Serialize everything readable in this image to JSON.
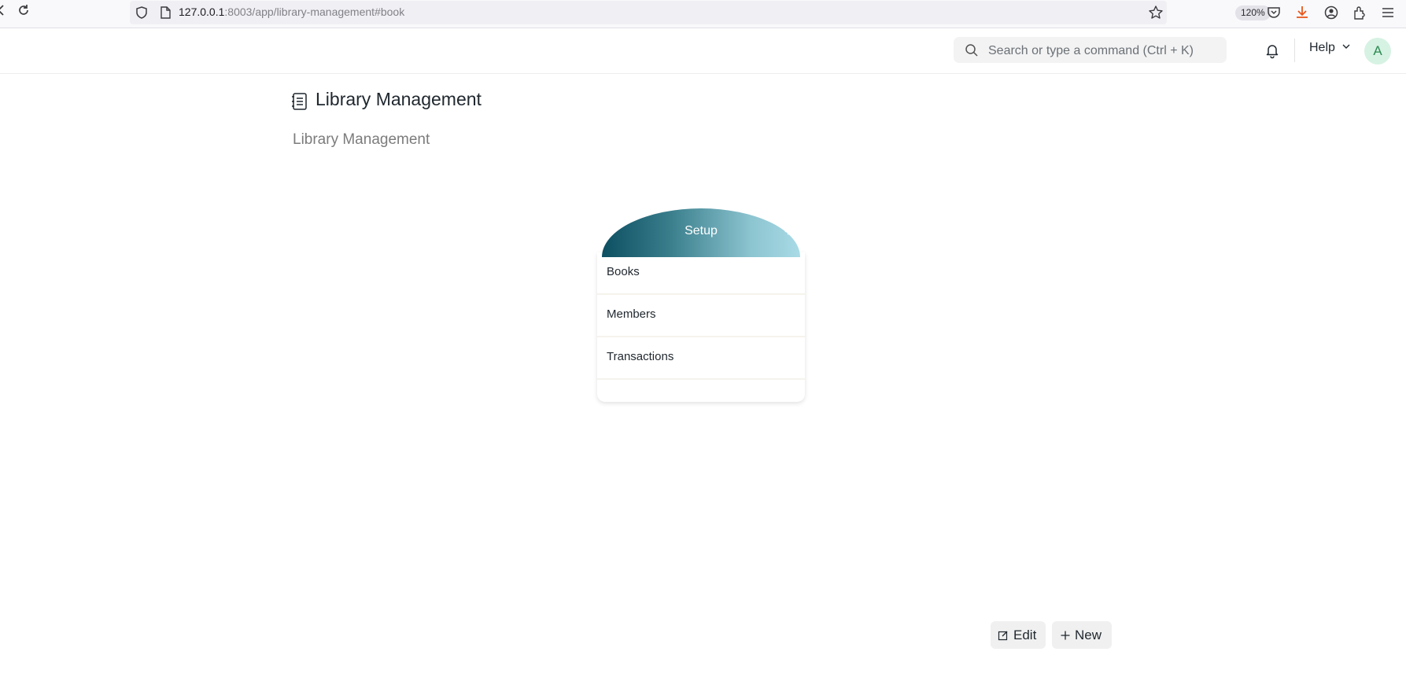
{
  "browser": {
    "url_host": "127.0.0.1",
    "url_path": ":8003/app/library-management#book",
    "zoom": "120%"
  },
  "navbar": {
    "search_placeholder": "Search or type a command (Ctrl + K)",
    "help_label": "Help",
    "avatar_initial": "A"
  },
  "page": {
    "title": "Library Management",
    "subtitle": "Library Management"
  },
  "card": {
    "title": "Setup",
    "items": [
      {
        "label": "Books"
      },
      {
        "label": "Members"
      },
      {
        "label": "Transactions"
      }
    ]
  },
  "actions": {
    "edit_label": "Edit",
    "new_label": "New"
  },
  "colors": {
    "card_gradient_start": "#0c4f62",
    "card_gradient_end": "#a8dbe6",
    "avatar_bg": "#d6f2e3",
    "download_icon": "#e8571c"
  }
}
